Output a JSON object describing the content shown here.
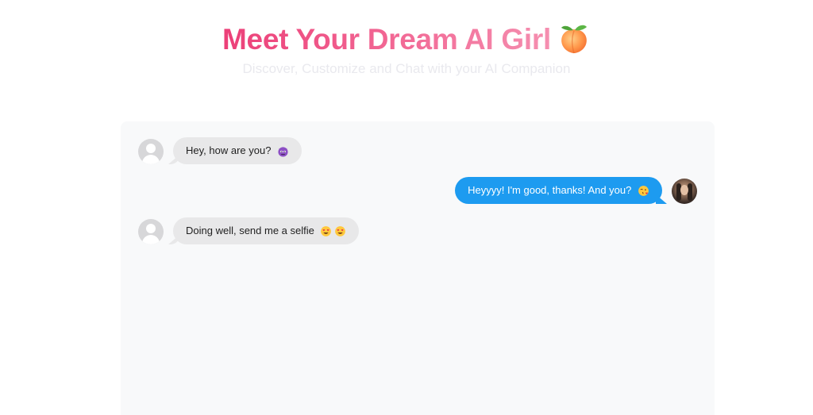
{
  "header": {
    "title": "Meet Your Dream AI Girl",
    "title_icon": "peach-icon",
    "subtitle": "Discover, Customize and Chat with your AI Companion"
  },
  "chat": {
    "messages": [
      {
        "direction": "incoming",
        "avatar": "default-user-avatar",
        "text": "Hey, how are you?",
        "emoji": [
          "purple-devil-face-emoji"
        ]
      },
      {
        "direction": "outgoing",
        "avatar": "user-photo-avatar",
        "text": "Heyyyy! I'm good, thanks! And you?",
        "emoji": [
          "face-blowing-kiss-emoji"
        ]
      },
      {
        "direction": "incoming",
        "avatar": "default-user-avatar",
        "text": "Doing well, send me a selfie",
        "emoji": [
          "heart-eyes-emoji",
          "heart-eyes-emoji"
        ]
      }
    ]
  },
  "colors": {
    "title_gradient_start": "#ec3f78",
    "title_gradient_end": "#f58fb0",
    "subtitle": "#e9e9ee",
    "panel_background": "#f8f9fa",
    "incoming_bubble": "#e8e8e9",
    "outgoing_bubble": "#1d9bf0"
  }
}
